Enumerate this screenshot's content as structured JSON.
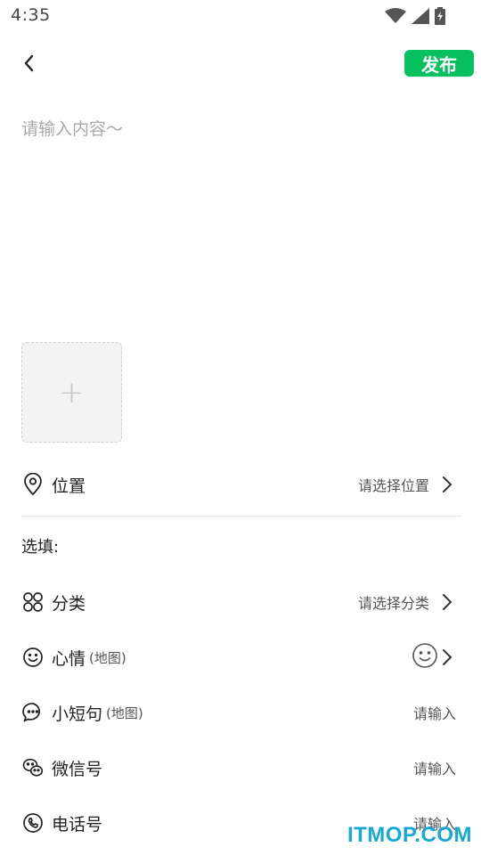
{
  "status_bar": {
    "time": "4:35"
  },
  "header": {
    "publish_label": "发布"
  },
  "editor": {
    "placeholder": "请输入内容～",
    "value": ""
  },
  "image_picker": {
    "add_symbol": "+"
  },
  "location": {
    "label": "位置",
    "value": "请选择位置"
  },
  "optional": {
    "title": "选填:",
    "category": {
      "label": "分类",
      "value": "请选择分类"
    },
    "mood": {
      "label": "心情",
      "sub": "(地图)"
    },
    "short_sentence": {
      "label": "小短句",
      "sub": "(地图)",
      "value": "请输入"
    },
    "wechat": {
      "label": "微信号",
      "value": "请输入"
    },
    "phone": {
      "label": "电话号",
      "value": "请输入"
    }
  },
  "colors": {
    "accent": "#07c160",
    "watermark": "#17a9d6"
  },
  "watermark": "ITMOP.COM"
}
